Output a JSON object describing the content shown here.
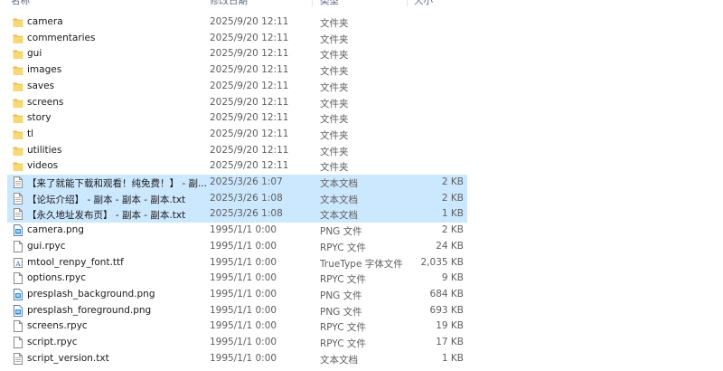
{
  "columns": {
    "name": "名称",
    "date": "修改日期",
    "type": "类型",
    "size": "大小"
  },
  "files": [
    {
      "name": "camera",
      "date": "2025/9/20 12:11",
      "type": "文件夹",
      "size": "",
      "icon": "folder-icon",
      "selected": false
    },
    {
      "name": "commentaries",
      "date": "2025/9/20 12:11",
      "type": "文件夹",
      "size": "",
      "icon": "folder-icon",
      "selected": false
    },
    {
      "name": "gui",
      "date": "2025/9/20 12:11",
      "type": "文件夹",
      "size": "",
      "icon": "folder-icon",
      "selected": false
    },
    {
      "name": "images",
      "date": "2025/9/20 12:11",
      "type": "文件夹",
      "size": "",
      "icon": "folder-icon",
      "selected": false
    },
    {
      "name": "saves",
      "date": "2025/9/20 12:11",
      "type": "文件夹",
      "size": "",
      "icon": "folder-icon",
      "selected": false
    },
    {
      "name": "screens",
      "date": "2025/9/20 12:11",
      "type": "文件夹",
      "size": "",
      "icon": "folder-icon",
      "selected": false
    },
    {
      "name": "story",
      "date": "2025/9/20 12:11",
      "type": "文件夹",
      "size": "",
      "icon": "folder-icon",
      "selected": false
    },
    {
      "name": "tl",
      "date": "2025/9/20 12:11",
      "type": "文件夹",
      "size": "",
      "icon": "folder-icon",
      "selected": false
    },
    {
      "name": "utilities",
      "date": "2025/9/20 12:11",
      "type": "文件夹",
      "size": "",
      "icon": "folder-icon",
      "selected": false
    },
    {
      "name": "videos",
      "date": "2025/9/20 12:11",
      "type": "文件夹",
      "size": "",
      "icon": "folder-icon",
      "selected": false
    },
    {
      "name": "【来了就能下载和观看！纯免费！】 - 副...",
      "date": "2025/3/26 1:07",
      "type": "文本文档",
      "size": "2 KB",
      "icon": "text-doc-icon",
      "selected": true
    },
    {
      "name": "【论坛介绍】 - 副本 - 副本 - 副本.txt",
      "date": "2025/3/26 1:08",
      "type": "文本文档",
      "size": "2 KB",
      "icon": "text-doc-icon",
      "selected": true
    },
    {
      "name": "【永久地址发布页】 - 副本 - 副本.txt",
      "date": "2025/3/26 1:08",
      "type": "文本文档",
      "size": "1 KB",
      "icon": "text-doc-icon",
      "selected": true
    },
    {
      "name": "camera.png",
      "date": "1995/1/1 0:00",
      "type": "PNG 文件",
      "size": "2 KB",
      "icon": "png-file-icon",
      "selected": false
    },
    {
      "name": "gui.rpyc",
      "date": "1995/1/1 0:00",
      "type": "RPYC 文件",
      "size": "24 KB",
      "icon": "generic-file-icon",
      "selected": false
    },
    {
      "name": "mtool_renpy_font.ttf",
      "date": "1995/1/1 0:00",
      "type": "TrueType 字体文件",
      "size": "2,035 KB",
      "icon": "font-file-icon",
      "selected": false
    },
    {
      "name": "options.rpyc",
      "date": "1995/1/1 0:00",
      "type": "RPYC 文件",
      "size": "9 KB",
      "icon": "generic-file-icon",
      "selected": false
    },
    {
      "name": "presplash_background.png",
      "date": "1995/1/1 0:00",
      "type": "PNG 文件",
      "size": "684 KB",
      "icon": "png-file-icon",
      "selected": false
    },
    {
      "name": "presplash_foreground.png",
      "date": "1995/1/1 0:00",
      "type": "PNG 文件",
      "size": "693 KB",
      "icon": "png-file-icon",
      "selected": false
    },
    {
      "name": "screens.rpyc",
      "date": "1995/1/1 0:00",
      "type": "RPYC 文件",
      "size": "19 KB",
      "icon": "generic-file-icon",
      "selected": false
    },
    {
      "name": "script.rpyc",
      "date": "1995/1/1 0:00",
      "type": "RPYC 文件",
      "size": "17 KB",
      "icon": "generic-file-icon",
      "selected": false
    },
    {
      "name": "script_version.txt",
      "date": "1995/1/1 0:00",
      "type": "文本文档",
      "size": "1 KB",
      "icon": "text-doc-icon",
      "selected": false
    }
  ],
  "colors": {
    "selection": "#cce8ff",
    "folder": "#f8d775",
    "folder_dark": "#e6b94a",
    "png_blue": "#2b88d8"
  }
}
